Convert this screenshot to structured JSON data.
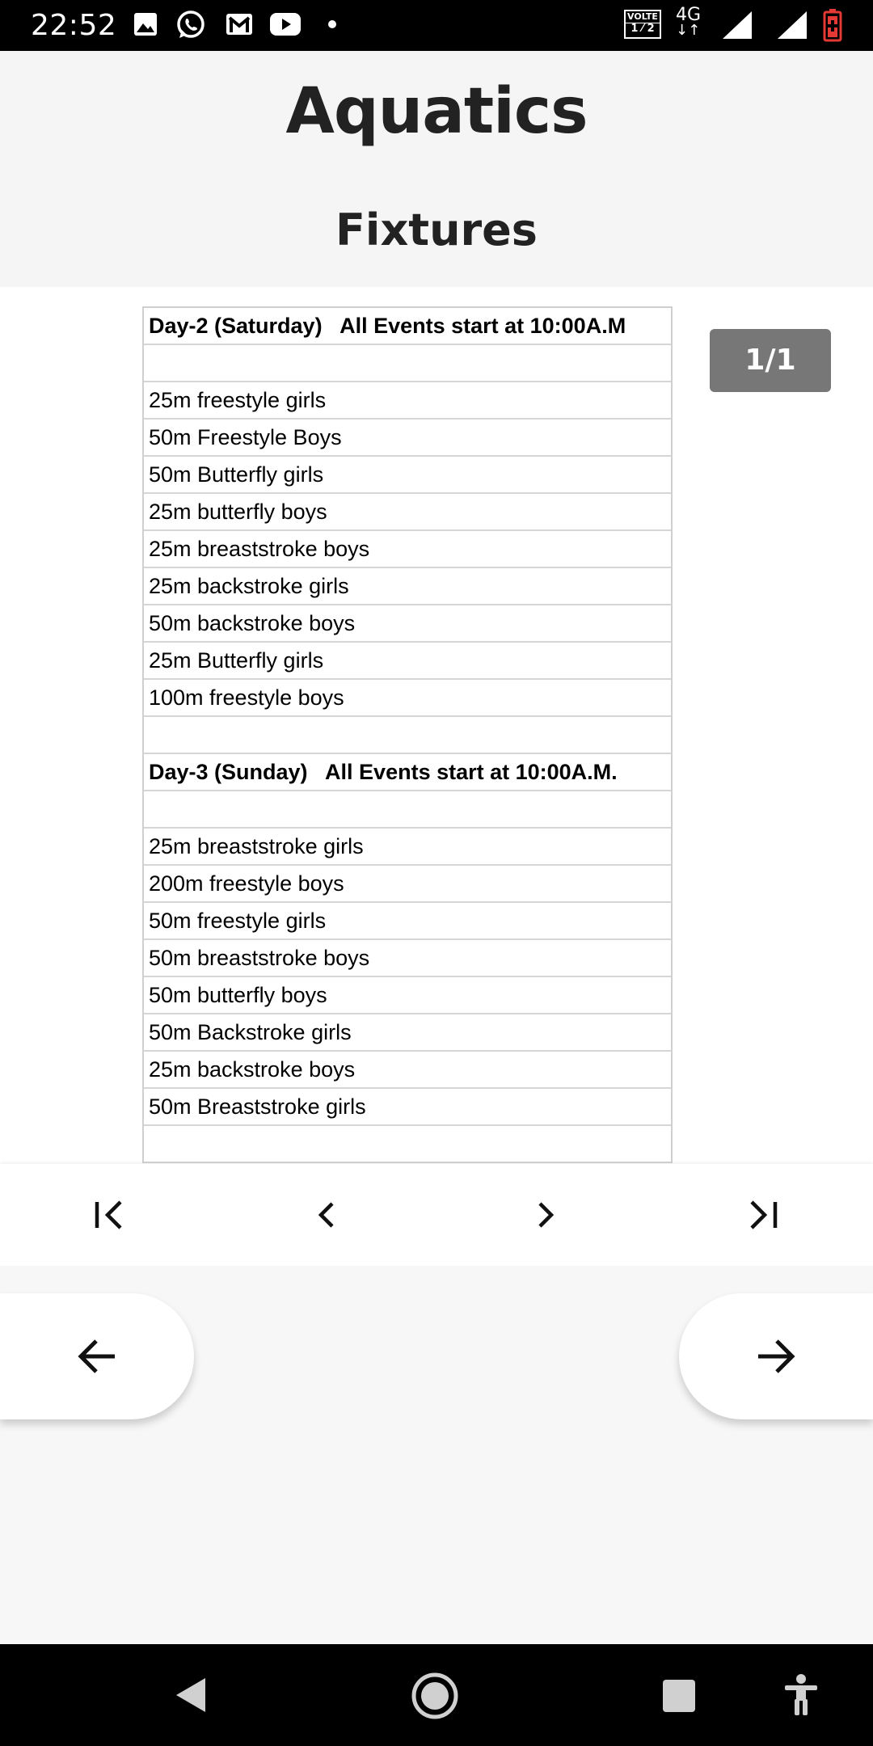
{
  "status_bar": {
    "time": "22:52",
    "icons": [
      "image-icon",
      "whatsapp-icon",
      "gmail-icon",
      "youtube-icon",
      "dot-icon"
    ],
    "volte_label": "VOLTE",
    "sim_label": "1 ⁄ 2",
    "network_label": "4G",
    "battery_color": "#e53935"
  },
  "header": {
    "title": "Aquatics",
    "subtitle": "Fixtures"
  },
  "document": {
    "rows": [
      {
        "text": "Day-2 (Saturday)   All Events start at 10:00A.M",
        "bold": true
      },
      {
        "text": "",
        "bold": false
      },
      {
        "text": "25m freestyle girls",
        "bold": false
      },
      {
        "text": "50m Freestyle Boys",
        "bold": false
      },
      {
        "text": "50m Butterfly girls",
        "bold": false
      },
      {
        "text": "25m butterfly boys",
        "bold": false
      },
      {
        "text": "25m breaststroke boys",
        "bold": false
      },
      {
        "text": "25m backstroke girls",
        "bold": false
      },
      {
        "text": "50m backstroke boys",
        "bold": false
      },
      {
        "text": "25m Butterfly girls",
        "bold": false
      },
      {
        "text": "100m freestyle boys",
        "bold": false
      },
      {
        "text": "",
        "bold": false
      },
      {
        "text": "Day-3 (Sunday)   All Events start at 10:00A.M.",
        "bold": true
      },
      {
        "text": "",
        "bold": false
      },
      {
        "text": "25m breaststroke girls",
        "bold": false
      },
      {
        "text": "200m freestyle boys",
        "bold": false
      },
      {
        "text": "50m freestyle girls",
        "bold": false
      },
      {
        "text": "50m breaststroke boys",
        "bold": false
      },
      {
        "text": "50m butterfly boys",
        "bold": false
      },
      {
        "text": "50m Backstroke girls",
        "bold": false
      },
      {
        "text": "25m backstroke boys",
        "bold": false
      },
      {
        "text": "50m Breaststroke girls",
        "bold": false
      },
      {
        "text": "",
        "bold": false
      }
    ],
    "page_indicator": "1/1"
  },
  "pager": {
    "icons": [
      "first-page-icon",
      "previous-page-icon",
      "next-page-icon",
      "last-page-icon"
    ]
  },
  "bottom_nav": {
    "icons": [
      "arrow-left-icon",
      "arrow-right-icon"
    ]
  },
  "system_nav": {
    "icons": [
      "back-icon",
      "home-icon",
      "recents-icon",
      "accessibility-icon"
    ]
  }
}
